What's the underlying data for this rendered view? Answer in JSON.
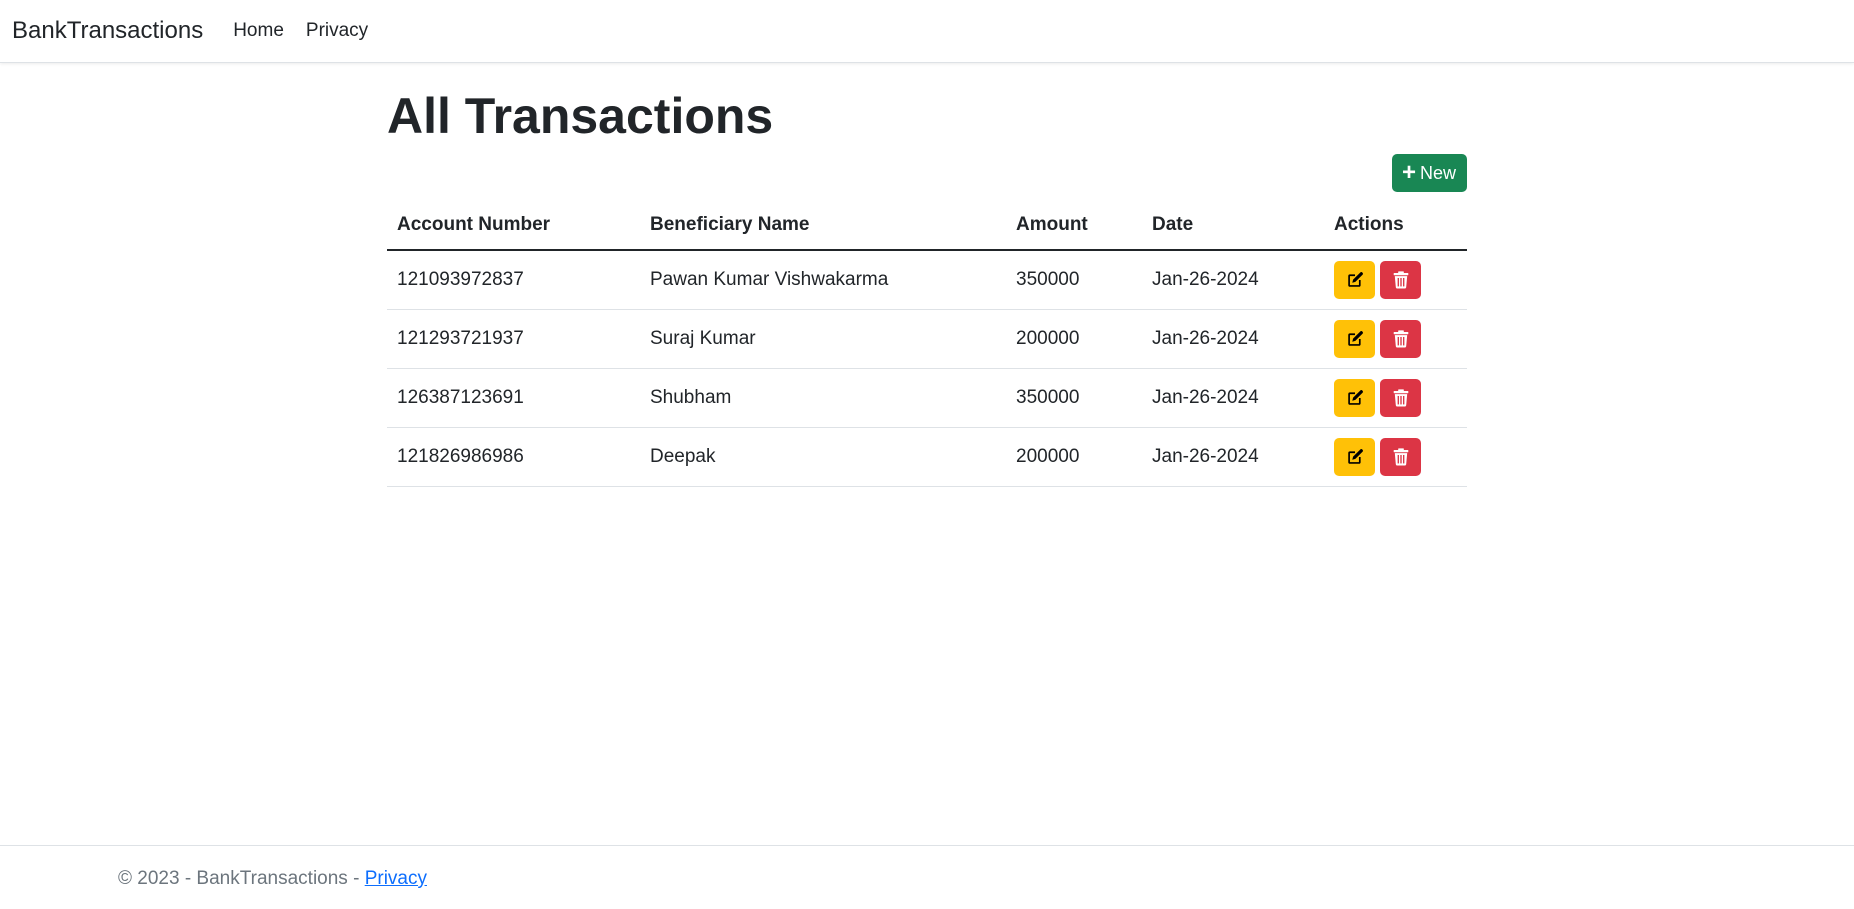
{
  "nav": {
    "brand": "BankTransactions",
    "links": [
      "Home",
      "Privacy"
    ]
  },
  "main": {
    "title": "All Transactions",
    "new_button_label": "New",
    "table": {
      "headers": [
        "Account Number",
        "Beneficiary Name",
        "Amount",
        "Date",
        "Actions"
      ],
      "rows": [
        {
          "account": "121093972837",
          "name": "Pawan Kumar Vishwakarma",
          "amount": "350000",
          "date": "Jan-26-2024"
        },
        {
          "account": "121293721937",
          "name": "Suraj Kumar",
          "amount": "200000",
          "date": "Jan-26-2024"
        },
        {
          "account": "126387123691",
          "name": "Shubham",
          "amount": "350000",
          "date": "Jan-26-2024"
        },
        {
          "account": "121826986986",
          "name": "Deepak",
          "amount": "200000",
          "date": "Jan-26-2024"
        }
      ]
    }
  },
  "footer": {
    "copyright": "© 2023 - BankTransactions - ",
    "privacy_link": "Privacy"
  },
  "colors": {
    "new_button": "#198754",
    "edit_button": "#ffc107",
    "delete_button": "#dc3545",
    "link": "#0d6efd"
  },
  "icons": {
    "new": "plus-icon",
    "edit": "edit-icon",
    "delete": "trash-icon"
  }
}
